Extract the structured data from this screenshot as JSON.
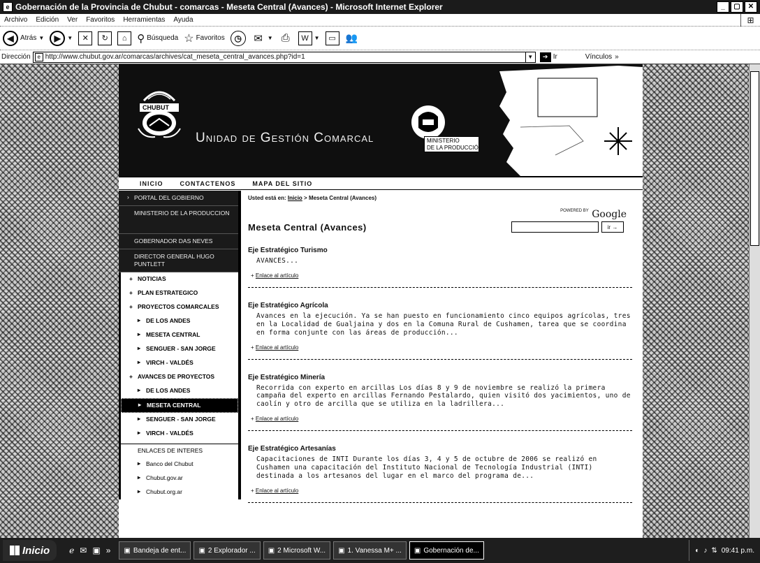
{
  "window": {
    "title": "Gobernación de la Provincia de Chubut - comarcas - Meseta Central (Avances) - Microsoft Internet Explorer"
  },
  "menu": [
    "Archivo",
    "Edición",
    "Ver",
    "Favoritos",
    "Herramientas",
    "Ayuda"
  ],
  "toolbar": {
    "back_label": "Atrás",
    "search_label": "Búsqueda",
    "favorites_label": "Favoritos"
  },
  "address": {
    "label": "Dirección",
    "url": "http://www.chubut.gov.ar/comarcas/archives/cat_meseta_central_avances.php?id=1",
    "go_label": "Ir",
    "links_label": "Vínculos"
  },
  "site": {
    "logo_text": "CHUBUT",
    "header_title": "Unidad de Gestión Comarcal",
    "ministerio_line1": "MINISTERIO",
    "ministerio_line2": "DE LA PRODUCCIÓN",
    "topnav": [
      "INICIO",
      "CONTACTENOS",
      "MAPA DEL SITIO"
    ]
  },
  "sidebar": {
    "dark_items": [
      "PORTAL DEL GOBIERNO",
      "MINISTERIO DE LA PRODUCCION",
      "GOBERNADOR DAS NEVES",
      "DIRECTOR GENERAL HUGO PUNTLETT"
    ],
    "nav_items": [
      {
        "label": "NOTICIAS",
        "type": "top"
      },
      {
        "label": "PLAN ESTRATEGICO",
        "type": "top"
      },
      {
        "label": "PROYECTOS COMARCALES",
        "type": "top"
      },
      {
        "label": "DE LOS ANDES",
        "type": "sub"
      },
      {
        "label": "MESETA CENTRAL",
        "type": "sub"
      },
      {
        "label": "SENGUER - SAN JORGE",
        "type": "sub"
      },
      {
        "label": "VIRCH - VALDÉS",
        "type": "sub"
      },
      {
        "label": "AVANCES DE PROYECTOS",
        "type": "top"
      },
      {
        "label": "DE LOS ANDES",
        "type": "sub"
      },
      {
        "label": "MESETA CENTRAL",
        "type": "sub",
        "active": true
      },
      {
        "label": "SENGUER - SAN JORGE",
        "type": "sub"
      },
      {
        "label": "VIRCH - VALDÉS",
        "type": "sub"
      }
    ],
    "links_header": "ENLACES DE INTERES",
    "links": [
      "Banco del Chubut",
      "Chubut.gov.ar",
      "Chubut.org.ar"
    ]
  },
  "main": {
    "breadcrumb_prefix": "Usted está en:",
    "breadcrumb_link": "Inicio",
    "breadcrumb_current": "> Meseta Central (Avances)",
    "search_powered": "POWERED BY",
    "search_brand": "Google",
    "search_button": "ir →",
    "page_title": "Meseta Central (Avances)",
    "more_label": "Enlace al artículo",
    "articles": [
      {
        "title": "Eje Estratégico Turismo",
        "body": "AVANCES..."
      },
      {
        "title": "Eje Estratégico Agrícola",
        "body": "Avances en la ejecución. Ya se han puesto en funcionamiento cinco equipos agrícolas, tres en la Localidad de Gualjaina y dos en la Comuna Rural de Cushamen, tarea que se coordina en forma conjunte con las áreas de producción..."
      },
      {
        "title": "Eje Estratégico Minería",
        "body": "Recorrida con experto en arcillas Los días 8 y 9 de noviembre se realizó la primera campaña del experto en arcillas Fernando Pestalardo, quien visitó dos yacimientos, uno de caolín y otro de arcilla que se utiliza en la ladrillera..."
      },
      {
        "title": "Eje Estratégico Artesanías",
        "body": "Capacitaciones de INTI Durante los días 3, 4 y 5 de octubre de 2006 se realizó en Cushamen una capacitación del Instituto Nacional de Tecnología Industrial (INTI) destinada a los artesanos del lugar en el marco del programa de..."
      }
    ]
  },
  "taskbar": {
    "start_label": "Inicio",
    "tasks": [
      "Bandeja de ent...",
      "2 Explorador ...",
      "2 Microsoft W...",
      "1. Vanessa M+ ...",
      "Gobernación de..."
    ],
    "clock": "09:41 p.m."
  }
}
